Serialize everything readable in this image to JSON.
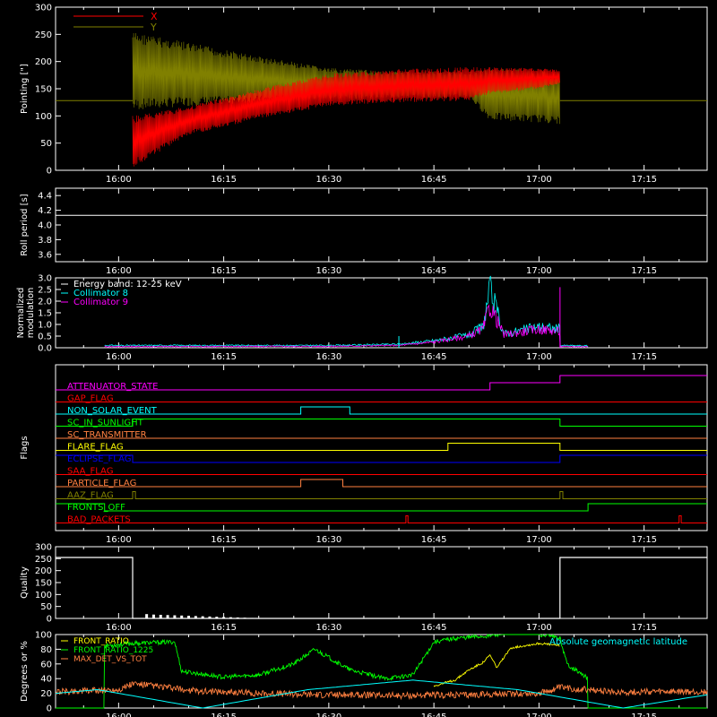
{
  "chart_data": [
    {
      "type": "line",
      "ylabel": "Pointing [\"]",
      "ylim": [
        0,
        300
      ],
      "yticks": [
        "0",
        "50",
        "100",
        "150",
        "200",
        "250",
        "300"
      ],
      "yvals": [
        0,
        50,
        100,
        150,
        200,
        250,
        300
      ],
      "xticks": [
        "16:00",
        "16:15",
        "16:30",
        "16:45",
        "17:00",
        "17:15"
      ],
      "legend": [
        {
          "name": "X",
          "color": "#ff0000"
        },
        {
          "name": "Y",
          "color": "#808000"
        }
      ],
      "baseline": 128,
      "active_range": [
        "16:02",
        "17:03"
      ],
      "series": [
        {
          "name": "X",
          "color": "#ff0000",
          "x": [
            "16:02",
            "16:10",
            "16:20",
            "16:30",
            "16:40",
            "16:50",
            "16:53",
            "17:00",
            "17:03"
          ],
          "upper": [
            100,
            118,
            150,
            178,
            186,
            190,
            190,
            188,
            185
          ],
          "lower": [
            5,
            65,
            95,
            118,
            125,
            128,
            140,
            150,
            160
          ]
        },
        {
          "name": "Y",
          "color": "#808000",
          "x": [
            "16:02",
            "16:10",
            "16:20",
            "16:30",
            "16:40",
            "16:50",
            "16:53",
            "17:00",
            "17:03"
          ],
          "upper": [
            255,
            235,
            210,
            188,
            182,
            182,
            188,
            185,
            180
          ],
          "lower": [
            110,
            118,
            125,
            130,
            133,
            133,
            92,
            88,
            85
          ]
        }
      ]
    },
    {
      "type": "line",
      "ylabel": "Roll period [s]",
      "ylim": [
        3.5,
        4.5
      ],
      "yticks": [
        "3.6",
        "3.8",
        "4.0",
        "4.2",
        "4.4"
      ],
      "yvals": [
        3.6,
        3.8,
        4.0,
        4.2,
        4.4
      ],
      "xticks": [
        "16:00",
        "16:15",
        "16:30",
        "16:45",
        "17:00",
        "17:15"
      ],
      "series": [
        {
          "name": "",
          "color": "#ffffff",
          "x": [
            "15:51",
            "17:24"
          ],
          "y": [
            4.13,
            4.13
          ]
        }
      ]
    },
    {
      "type": "line",
      "ylabel": "Normalized modulation",
      "ylim": [
        0,
        3.0
      ],
      "yticks": [
        "0.0",
        "0.5",
        "1.0",
        "1.5",
        "2.0",
        "2.5",
        "3.0"
      ],
      "yvals": [
        0,
        0.5,
        1.0,
        1.5,
        2.0,
        2.5,
        3.0
      ],
      "xticks": [
        "16:00",
        "16:15",
        "16:30",
        "16:45",
        "17:00",
        "17:15"
      ],
      "legend": [
        {
          "name": "Energy band: 12-25 keV",
          "color": "#ffffff"
        },
        {
          "name": "Collimator 8",
          "color": "#00ffff"
        },
        {
          "name": "Collimator 9",
          "color": "#ff00ff"
        }
      ],
      "series": [
        {
          "name": "Collimator 8",
          "color": "#00ffff",
          "x": [
            "15:58",
            "16:30",
            "16:40",
            "16:45",
            "16:50",
            "16:52",
            "16:53",
            "16:55",
            "17:00",
            "17:03",
            "17:03",
            "17:07"
          ],
          "y": [
            0.1,
            0.1,
            0.15,
            0.3,
            0.55,
            0.9,
            2.5,
            0.6,
            0.9,
            0.8,
            0.1,
            0.08
          ]
        },
        {
          "name": "Collimator 9",
          "color": "#ff00ff",
          "x": [
            "15:58",
            "16:30",
            "16:40",
            "16:45",
            "16:50",
            "16:52",
            "16:53",
            "16:55",
            "17:00",
            "17:03",
            "17:03",
            "17:07"
          ],
          "y": [
            0.05,
            0.06,
            0.1,
            0.25,
            0.5,
            0.8,
            1.8,
            0.55,
            0.8,
            0.7,
            0.05,
            0.05
          ]
        }
      ],
      "spikes": [
        {
          "x": "16:40",
          "y": 0.5,
          "color": "#00ffff"
        },
        {
          "x": "17:03",
          "y": 2.6,
          "color": "#ff00ff"
        }
      ]
    },
    {
      "type": "line",
      "ylabel": "Flags",
      "xticks": [
        "16:00",
        "16:15",
        "16:30",
        "16:45",
        "17:00",
        "17:15"
      ],
      "flags": [
        {
          "name": "ATTENUATOR_STATE",
          "color": "#ff00ff",
          "steps": [
            [
              "15:51",
              0
            ],
            [
              "16:53",
              1
            ],
            [
              "17:03",
              2
            ]
          ]
        },
        {
          "name": "GAP_FLAG",
          "color": "#ff0000",
          "steps": [
            [
              "15:51",
              0
            ]
          ]
        },
        {
          "name": "NON_SOLAR_EVENT",
          "color": "#00ffff",
          "steps": [
            [
              "15:51",
              0
            ],
            [
              "16:26",
              1
            ],
            [
              "16:33",
              0
            ]
          ]
        },
        {
          "name": "SC_IN_SUNLIGHT",
          "color": "#00ff00",
          "steps": [
            [
              "15:51",
              0
            ],
            [
              "16:02",
              1
            ],
            [
              "17:03",
              0
            ]
          ]
        },
        {
          "name": "SC_TRANSMITTER",
          "color": "#ff8040",
          "steps": [
            [
              "15:51",
              0
            ]
          ]
        },
        {
          "name": "FLARE_FLAG",
          "color": "#ffff00",
          "steps": [
            [
              "15:51",
              0
            ],
            [
              "16:47",
              1
            ],
            [
              "17:03",
              0
            ]
          ]
        },
        {
          "name": "ECLIPSE_FLAG",
          "color": "#0000ff",
          "steps": [
            [
              "15:51",
              1
            ],
            [
              "16:02",
              0
            ],
            [
              "17:03",
              1
            ]
          ]
        },
        {
          "name": "SAA_FLAG",
          "color": "#ff0000",
          "steps": [
            [
              "15:51",
              0
            ]
          ]
        },
        {
          "name": "PARTICLE_FLAG",
          "color": "#ff8040",
          "steps": [
            [
              "15:51",
              0
            ],
            [
              "16:26",
              1
            ],
            [
              "16:32",
              0
            ]
          ]
        },
        {
          "name": "AAZ_FLAG",
          "color": "#808000",
          "steps": [
            [
              "15:51",
              0
            ],
            [
              "16:02",
              1
            ],
            [
              "16:02.4",
              0
            ],
            [
              "17:03",
              1
            ],
            [
              "17:03.4",
              0
            ]
          ]
        },
        {
          "name": "FRONTS_OFF",
          "color": "#00ff00",
          "steps": [
            [
              "15:51",
              1
            ],
            [
              "15:58",
              0
            ],
            [
              "17:07",
              1
            ]
          ]
        },
        {
          "name": "BAD_PACKETS",
          "color": "#ff0000",
          "steps": [
            [
              "15:51",
              0
            ],
            [
              "16:41",
              1
            ],
            [
              "16:41.3",
              0
            ],
            [
              "17:20",
              1
            ],
            [
              "17:20.3",
              0
            ]
          ]
        }
      ]
    },
    {
      "type": "line",
      "ylabel": "Quality",
      "ylim": [
        0,
        300
      ],
      "yticks": [
        "0",
        "50",
        "100",
        "150",
        "200",
        "250",
        "300"
      ],
      "yvals": [
        0,
        50,
        100,
        150,
        200,
        250,
        300
      ],
      "xticks": [
        "16:00",
        "16:15",
        "16:30",
        "16:45",
        "17:00",
        "17:15"
      ],
      "series": [
        {
          "name": "",
          "color": "#ffffff",
          "x": [
            "15:51",
            "16:02",
            "16:02",
            "17:03",
            "17:03",
            "17:24"
          ],
          "y": [
            255,
            255,
            0,
            0,
            255,
            255
          ]
        }
      ],
      "blips": [
        "16:04",
        "16:05",
        "16:06",
        "16:07",
        "16:08",
        "16:09",
        "16:10",
        "16:11",
        "16:12",
        "16:13",
        "16:14",
        "16:15",
        "16:16",
        "16:17",
        "16:18",
        "16:19"
      ],
      "blip_heights": [
        18,
        16,
        15,
        14,
        13,
        12,
        11,
        10,
        9,
        8,
        7,
        6,
        5,
        4,
        3,
        2
      ]
    },
    {
      "type": "line",
      "ylabel": "Degrees or %",
      "ylim": [
        0,
        100
      ],
      "yticks": [
        "0",
        "20",
        "40",
        "60",
        "80",
        "100"
      ],
      "yvals": [
        0,
        20,
        40,
        60,
        80,
        100
      ],
      "xticks": [
        "16:00",
        "16:15",
        "16:30",
        "16:45",
        "17:00",
        "17:15"
      ],
      "legend": [
        {
          "name": "FRONT_RATIO",
          "color": "#ffff00"
        },
        {
          "name": "FRONT_RATIO_1225",
          "color": "#00ff00"
        },
        {
          "name": "MAX_DET_VS_TOT",
          "color": "#ff8040"
        }
      ],
      "annotation": {
        "text": "Absolute geomagnetic latitude",
        "color": "#00ffff"
      },
      "series": [
        {
          "name": "FRONT_RATIO_1225",
          "color": "#00ff00",
          "x": [
            "15:51",
            "15:58",
            "15:58",
            "16:02",
            "16:08",
            "16:09",
            "16:15",
            "16:20",
            "16:25",
            "16:28",
            "16:33",
            "16:38",
            "16:42",
            "16:45",
            "16:48",
            "16:55",
            "17:00",
            "17:03",
            "17:04",
            "17:07",
            "17:07",
            "17:24"
          ],
          "y": [
            0,
            0,
            85,
            88,
            90,
            50,
            42,
            45,
            60,
            80,
            52,
            40,
            45,
            90,
            95,
            100,
            100,
            95,
            60,
            40,
            0,
            0
          ]
        },
        {
          "name": "FRONT_RATIO",
          "color": "#ffff00",
          "x": [
            "16:45",
            "16:48",
            "16:50",
            "16:52",
            "16:53",
            "16:54",
            "16:56",
            "17:00",
            "17:03"
          ],
          "y": [
            30,
            38,
            52,
            62,
            72,
            55,
            82,
            88,
            85
          ]
        },
        {
          "name": "MAX_DET_VS_TOT",
          "color": "#ff8040",
          "x": [
            "15:51",
            "16:00",
            "16:02",
            "16:05",
            "16:10",
            "16:20",
            "16:30",
            "16:40",
            "16:50",
            "17:00",
            "17:03",
            "17:10",
            "17:24"
          ],
          "y": [
            22,
            25,
            33,
            30,
            24,
            20,
            18,
            17,
            18,
            20,
            28,
            22,
            22
          ]
        },
        {
          "name": "Absolute geomagnetic latitude",
          "color": "#00ffff",
          "x": [
            "15:51",
            "15:57",
            "16:12",
            "16:27",
            "16:42",
            "16:57",
            "17:12",
            "17:24"
          ],
          "y": [
            20,
            25,
            0,
            25,
            38,
            25,
            0,
            18
          ]
        }
      ]
    }
  ]
}
